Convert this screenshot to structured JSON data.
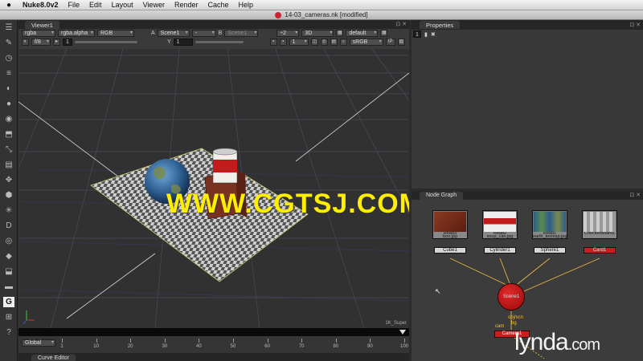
{
  "menubar": {
    "app": "Nuke8.0v2",
    "items": [
      "File",
      "Edit",
      "Layout",
      "Viewer",
      "Render",
      "Cache",
      "Help"
    ]
  },
  "window": {
    "title": "14-03_cameras.nk [modified]"
  },
  "viewer": {
    "tab": "Viewer1",
    "channels": "rgba",
    "alpha": "rgba.alpha",
    "colorspace_display": "RGB",
    "input_a_label": "A",
    "input_a": "Scene1",
    "input_a_op": "-",
    "input_b_label": "B",
    "input_b": "Scene1",
    "downscale": "÷2",
    "view_mode": "3D",
    "camera": "default",
    "fstop": "f/8",
    "gain": "1",
    "gamma_label": "Y",
    "gamma": "1",
    "frame_num": "1",
    "lut": "sRGB",
    "ip": "IP",
    "format": "1K_Super",
    "watermark": "WWW.CGTSJ.COM"
  },
  "playback": {
    "frame": "1",
    "increment": "10",
    "fps_label": "fps",
    "fps": "24",
    "range": "Global",
    "ticks": [
      "1",
      "10",
      "20",
      "30",
      "40",
      "50",
      "60",
      "70",
      "80",
      "90",
      "100"
    ]
  },
  "bottom_tab": "Curve Editor",
  "properties": {
    "tab": "Properties",
    "max_panels": "1"
  },
  "nodegraph": {
    "tab": "Node Graph",
    "nodes": [
      {
        "label": "Read3\nbox.jpg",
        "op": "Cube1"
      },
      {
        "label": "Read2\nsoup_can.jpg",
        "op": "Cylinder1"
      },
      {
        "label": "Read1\nearth_texmap.jpg",
        "op": "Sphere1"
      },
      {
        "label": "CheckerBoard1",
        "op": "Card1"
      }
    ],
    "scene": "Scene1",
    "obj_label": "obj/scn",
    "bg_label": "bg",
    "cam_label": "cam",
    "camera": "Camera1"
  },
  "branding": {
    "lynda": "lynda",
    "lynda_tld": ".com"
  },
  "colors": {
    "accent_red": "#c81e1e",
    "watermark_yellow": "#ffee00",
    "connector": "#e5b847"
  }
}
